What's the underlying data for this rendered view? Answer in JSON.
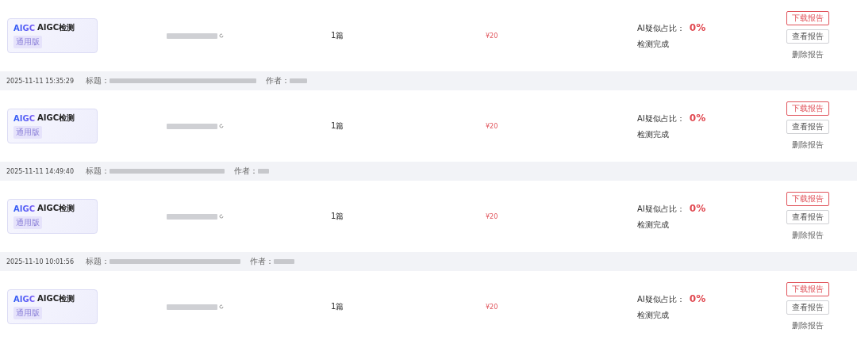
{
  "records": [
    {
      "product": {
        "logo": "AIGC",
        "name": "AIGC检测",
        "edition": "通用版"
      },
      "count": "1篇",
      "price": "¥20",
      "ai_label": "AI疑似占比：",
      "ai_value": "0%",
      "status": "检测完成",
      "actions": [
        "下载报告",
        "查看报告",
        "删除报告"
      ]
    },
    {
      "header": {
        "time": "2025-11-11 15:35:29",
        "title_label": "标题：",
        "author_label": "作者："
      },
      "product": {
        "logo": "AIGC",
        "name": "AIGC检测",
        "edition": "通用版"
      },
      "count": "1篇",
      "price": "¥20",
      "ai_label": "AI疑似占比：",
      "ai_value": "0%",
      "status": "检测完成",
      "actions": [
        "下载报告",
        "查看报告",
        "删除报告"
      ]
    },
    {
      "header": {
        "time": "2025-11-11 14:49:40",
        "title_label": "标题：",
        "author_label": "作者："
      },
      "product": {
        "logo": "AIGC",
        "name": "AIGC检测",
        "edition": "通用版"
      },
      "count": "1篇",
      "price": "¥20",
      "ai_label": "AI疑似占比：",
      "ai_value": "0%",
      "status": "检测完成",
      "actions": [
        "下载报告",
        "查看报告",
        "删除报告"
      ]
    },
    {
      "header": {
        "time": "2025-11-10 10:01:56",
        "title_label": "标题：",
        "author_label": "作者："
      },
      "product": {
        "logo": "AIGC",
        "name": "AIGC检测",
        "edition": "通用版"
      },
      "count": "1篇",
      "price": "¥20",
      "ai_label": "AI疑似占比：",
      "ai_value": "0%",
      "status": "检测完成",
      "actions": [
        "下载报告",
        "查看报告",
        "删除报告"
      ]
    }
  ]
}
